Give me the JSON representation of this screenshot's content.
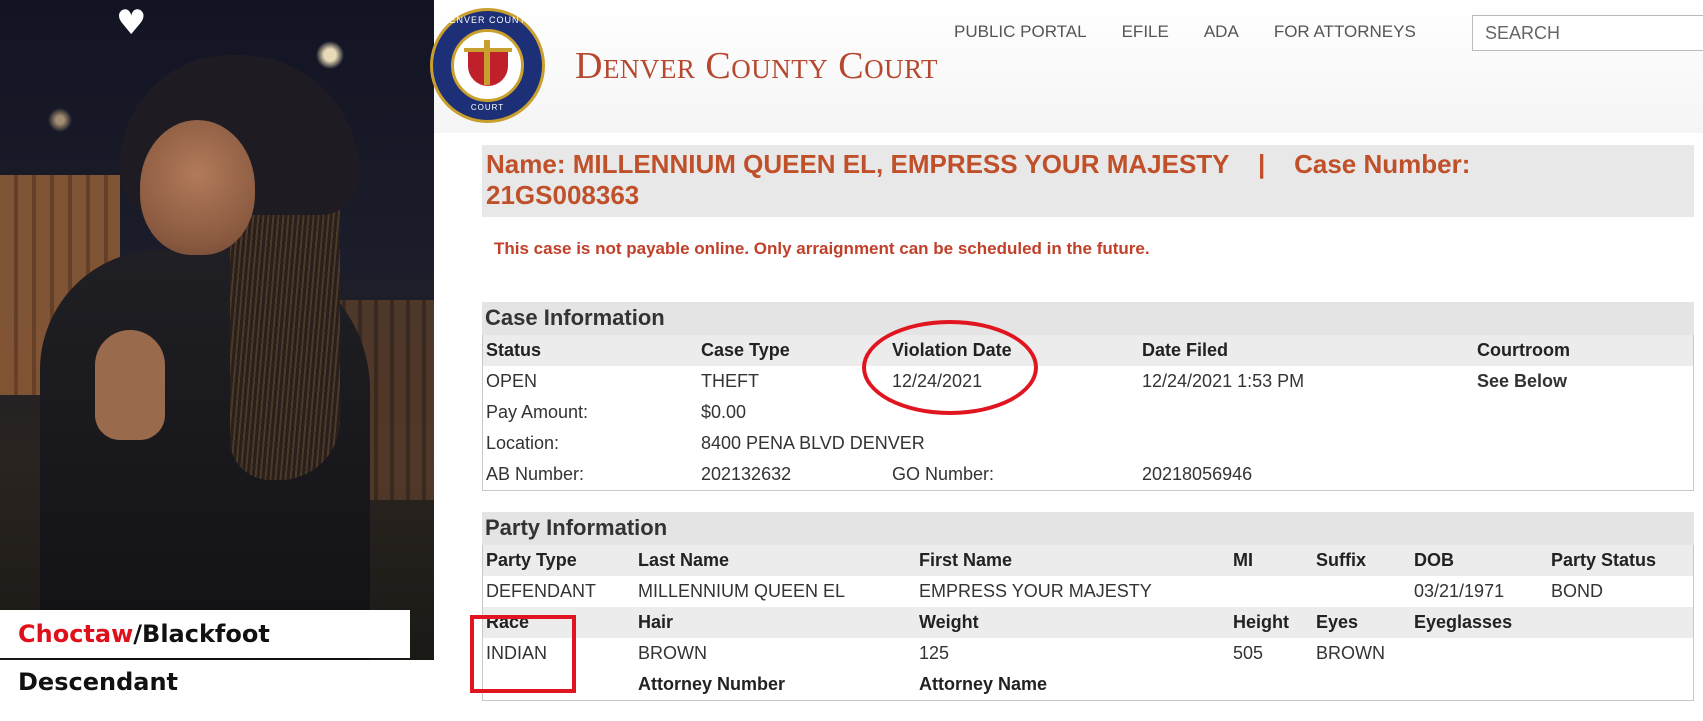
{
  "photo": {
    "caption_part1": "Choctaw",
    "caption_part2": "/Blackfoot Descendant"
  },
  "header": {
    "seal_top_text": "DENVER COUNTY",
    "seal_bottom_text": "COURT",
    "court_title": "Denver County Court",
    "nav": [
      "PUBLIC PORTAL",
      "EFILE",
      "ADA",
      "FOR ATTORNEYS"
    ],
    "search_placeholder": "SEARCH"
  },
  "case": {
    "title_line1": "Name: MILLENNIUM QUEEN EL, EMPRESS YOUR MAJESTY    |    Case Number:",
    "title_line2": "21GS008363",
    "notice": "This case is not payable online. Only arraignment can be scheduled in the future."
  },
  "case_information": {
    "section_title": "Case Information",
    "headers": [
      "Status",
      "Case Type",
      "Violation Date",
      "Date Filed",
      "Courtroom"
    ],
    "values": [
      "OPEN",
      "THEFT",
      "12/24/2021",
      "12/24/2021 1:53 PM",
      "See Below"
    ],
    "pay_amount_label": "Pay Amount:",
    "pay_amount": "$0.00",
    "location_label": "Location:",
    "location": "8400 PENA BLVD DENVER",
    "ab_number_label": "AB Number:",
    "ab_number": "202132632",
    "go_number_label": "GO Number:",
    "go_number": "20218056946"
  },
  "party_information": {
    "section_title": "Party Information",
    "headers1": [
      "Party Type",
      "Last Name",
      "First Name",
      "MI",
      "Suffix",
      "DOB",
      "Party Status"
    ],
    "values1": [
      "DEFENDANT",
      "MILLENNIUM QUEEN EL",
      "EMPRESS YOUR MAJESTY",
      "",
      "",
      "03/21/1971",
      "BOND"
    ],
    "headers2": [
      "Race",
      "Hair",
      "Weight",
      "Height",
      "Eyes",
      "Eyeglasses"
    ],
    "values2": [
      "INDIAN",
      "BROWN",
      "125",
      "505",
      "BROWN",
      ""
    ],
    "headers3": [
      "Attorney Number",
      "Attorney Name"
    ]
  },
  "colors": {
    "court_title": "#b5482e",
    "case_heading": "#c0502a",
    "annotation_red": "#e01520",
    "caption_red": "#e0101a"
  }
}
